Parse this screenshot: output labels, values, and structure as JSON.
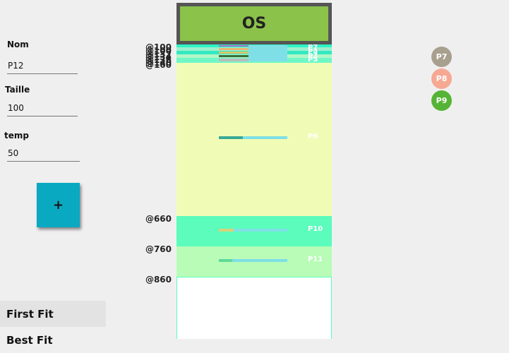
{
  "form": {
    "name_label": "Nom",
    "name_value": "P12",
    "size_label": "Taille",
    "size_value": "100",
    "time_label": "temp",
    "time_value": "50",
    "add_label": "+"
  },
  "menu": [
    "First Fit",
    "Best Fit"
  ],
  "memory": {
    "os_label": "OS",
    "addresses": {
      "a1": "@100",
      "a2": "@100",
      "a3": "@132",
      "a4": "@134",
      "a5": "@136",
      "a6": "@140",
      "a7": "@160",
      "a660": "@660",
      "a760": "@760",
      "a860": "@860"
    },
    "processes": {
      "p6": "P6",
      "p7": "P7",
      "p4": "P4",
      "p3": "P3",
      "p5": "P5",
      "p10": "P10",
      "p11": "P11"
    },
    "progress": {
      "p6": 0.35,
      "p10": 0.22,
      "p11": 0.2
    }
  },
  "queue": [
    {
      "label": "P7",
      "color": "#a8a08e"
    },
    {
      "label": "P8",
      "color": "#f7a892"
    },
    {
      "label": "P9",
      "color": "#55b435"
    }
  ],
  "colors": {
    "os": "#8bc24a",
    "os_border": "#555555",
    "free_block": "#f0fcb5",
    "block_p10": "#5bfcbc",
    "block_p11": "#b8fcb7",
    "accent": "#0aa9c2"
  }
}
